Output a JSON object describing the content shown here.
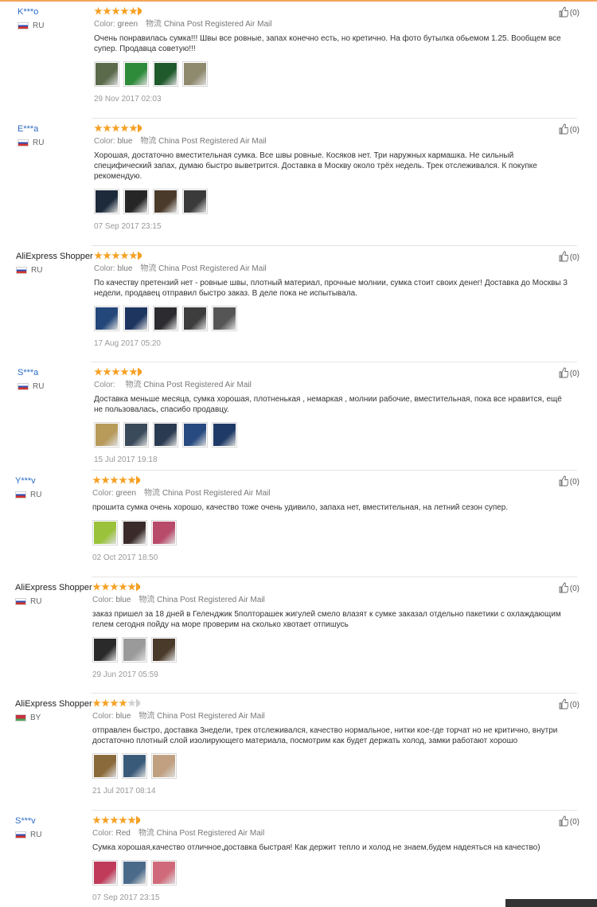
{
  "labels": {
    "color": "Color:",
    "shipping_method": "China Post Registered Air Mail",
    "shipping_prefix": "物流"
  },
  "reviews": [
    {
      "user": "K***o",
      "country": "RU",
      "flag": "ru",
      "stars": 5,
      "color_value": "green",
      "text": "Очень понравилась сумка!!! Швы все ровные, запах конечно есть, но кретично. На фото бутылка обьемом 1.25. Вообщем все супер. Продавца советую!!!",
      "date": "29 Nov 2017 02:03",
      "likes": "(0)",
      "photos": [
        "#5a6a4a",
        "#2e8b3a",
        "#1f5a2c",
        "#8f8a6e"
      ]
    },
    {
      "user": "E***a",
      "country": "RU",
      "flag": "ru",
      "stars": 5,
      "color_value": "blue",
      "text": "Хорошая, достаточно вместительная сумка. Все швы ровные. Косяков нет. Три наружных кармашка. Не сильный специфический запах, думаю быстро выветрится. Доставка в Москву около трёх недель. Трек отслеживался. К покупке рекомендую.",
      "date": "07 Sep 2017 23:15",
      "likes": "(0)",
      "photos": [
        "#1c2a3a",
        "#262626",
        "#4a3a2a",
        "#3a3a3a"
      ]
    },
    {
      "user": "AliExpress Shopper",
      "country": "RU",
      "flag": "ru",
      "stars": 5,
      "color_value": "blue",
      "text": "По качеству претензий нет - ровные швы, плотный материал, прочные молнии, сумка стоит своих денег! Доставка до Москвы 3 недели, продавец отправил быстро заказ. В деле пока не испытывала.",
      "date": "17 Aug 2017 05:20",
      "likes": "(0)",
      "photos": [
        "#24477a",
        "#1e3560",
        "#2b2b30",
        "#3d3d3d",
        "#555555"
      ]
    },
    {
      "user": "S***a",
      "country": "RU",
      "flag": "ru",
      "stars": 5,
      "color_value": "",
      "text": "Доставка меньше месяца, сумка хорошая, плотненькая , немаркая , молнии рабочие, вместительная, пока все нравится, ещё не пользовалась, спасибо продавцу.",
      "date": "15 Jul 2017 19:18",
      "likes": "(0)",
      "photos": [
        "#b89a5a",
        "#3a4a5a",
        "#2a3a50",
        "#274a80",
        "#1f3a66"
      ]
    },
    {
      "user": "Y***v",
      "country": "RU",
      "flag": "ru",
      "stars": 5,
      "color_value": "green",
      "text": "прошита сумка очень хорошо, качество тоже очень удивило, запаха нет, вместительная, на летний сезон супер.",
      "date": "02 Oct 2017 18:50",
      "likes": "(0)",
      "photos": [
        "#9ac23a",
        "#3a2a2a",
        "#b84a6a"
      ]
    },
    {
      "user": "AliExpress Shopper",
      "country": "RU",
      "flag": "ru",
      "stars": 5,
      "color_value": "blue",
      "text": "заказ пришел за 18 дней в Геленджик 5полторашек жигулей смело влазят к сумке заказал отдельно пакетики с охлаждающим гелем сегодня пойду на море проверим на сколько хвотает отпишусь",
      "date": "29 Jun 2017 05:59",
      "likes": "(0)",
      "photos": [
        "#2a2a2a",
        "#9a9a9a",
        "#4a3a2a"
      ]
    },
    {
      "user": "AliExpress Shopper",
      "country": "BY",
      "flag": "by",
      "stars": 4,
      "color_value": "blue",
      "text": "отправлен быстро, доставка 3недели, трек отслеживался, качество нормальное, нитки кое-где торчат но не критично, внутри достаточно плотный слой изолирующего материала, посмотрим как будет держать холод, замки работают хорошо",
      "date": "21 Jul 2017 08:14",
      "likes": "(0)",
      "photos": [
        "#8a6a3a",
        "#3a5a7a",
        "#c0a080"
      ]
    },
    {
      "user": "S***v",
      "country": "RU",
      "flag": "ru",
      "stars": 5,
      "color_value": "Red",
      "text": "Сумка хорошая,качество отличное,доставка быстрая! Как держит тепло и холод не знаем,будем надеяться на качество)",
      "date": "07 Sep 2017 23:15",
      "likes": "(0)",
      "photos": [
        "#c03a5a",
        "#4a6a8a",
        "#d06a7a"
      ]
    }
  ]
}
